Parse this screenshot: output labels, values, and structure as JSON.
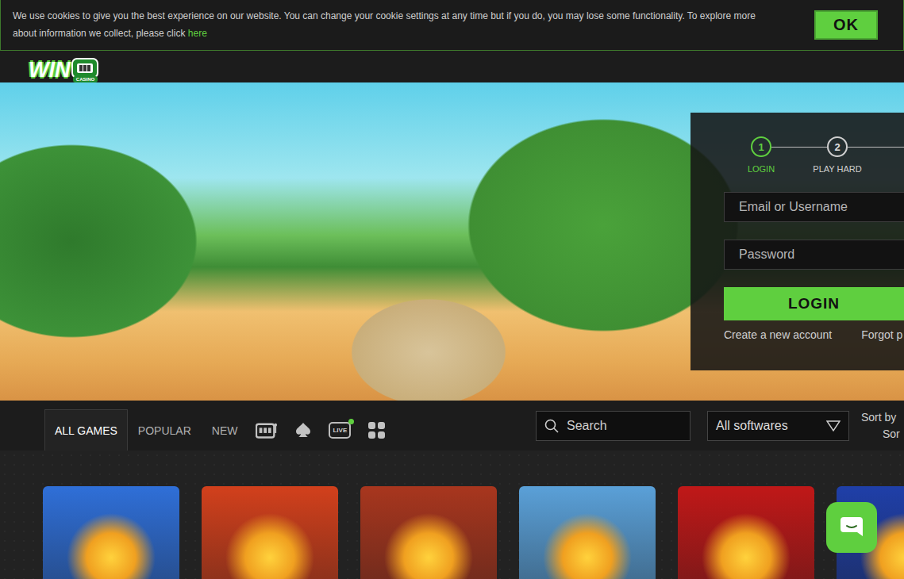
{
  "cookie_banner": {
    "text": "We use cookies to give you the best experience on our website. You can change your cookie settings at any time but if you do, you may lose some functionality. To explore more about information we collect, please click",
    "link": "here",
    "button": "OK"
  },
  "logo": {
    "title": "WIN",
    "subtitle": "CASINO"
  },
  "login": {
    "steps": [
      {
        "number": "1",
        "label": "LOGIN",
        "selected": true
      },
      {
        "number": "2",
        "label": "PLAY HARD",
        "selected": false
      }
    ],
    "fields": [
      {
        "placeholder": "Email or Username",
        "kind": "text"
      },
      {
        "placeholder": "Password",
        "kind": "password"
      }
    ],
    "button": "LOGIN",
    "links": [
      "Create a new account",
      "Forgot p"
    ]
  },
  "nav": {
    "tabs": [
      {
        "label": "ALL GAMES",
        "selected": true
      },
      {
        "label": "POPULAR",
        "selected": false
      },
      {
        "label": "NEW",
        "selected": false
      }
    ],
    "categories": [
      {
        "kind": "slots"
      },
      {
        "kind": "table"
      },
      {
        "kind": "live",
        "label": "LIVE",
        "online": true
      },
      {
        "kind": "all"
      }
    ],
    "search": {
      "placeholder": "Search"
    },
    "software_filter": {
      "value": "All softwares"
    },
    "sort": {
      "label": "Sort by",
      "value": "Sor"
    }
  },
  "games": [
    {
      "color": "#2f6fd8"
    },
    {
      "color": "#d2401c"
    },
    {
      "color": "#a8361e"
    },
    {
      "color": "#5aa0d8"
    },
    {
      "color": "#c01818"
    },
    {
      "color": "#1f3fa8"
    }
  ]
}
